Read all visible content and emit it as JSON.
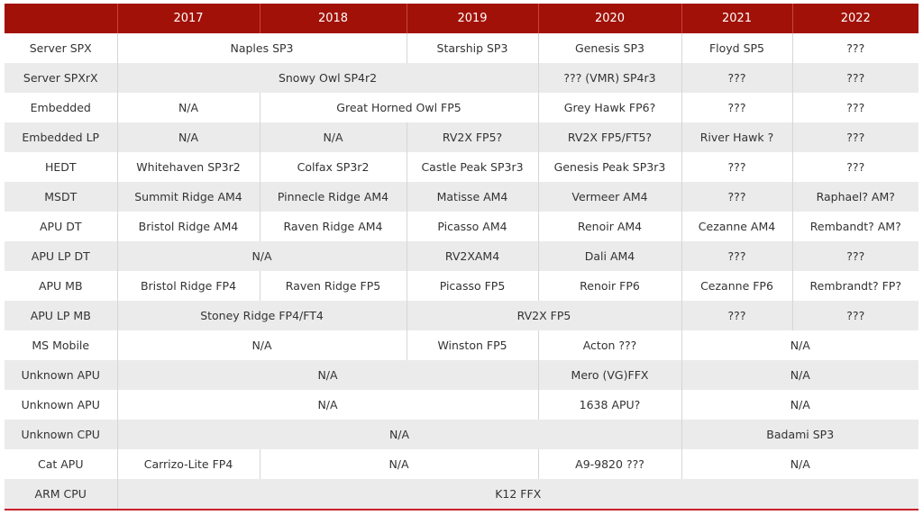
{
  "table": {
    "header": {
      "corner": "",
      "years": [
        "2017",
        "2018",
        "2019",
        "2020",
        "2021",
        "2022"
      ]
    },
    "accent_color": "#a11107",
    "rows": [
      {
        "label": "Server SPX",
        "cells": [
          {
            "text": "Naples SP3",
            "span": 2
          },
          {
            "text": "Starship SP3",
            "span": 1
          },
          {
            "text": "Genesis SP3",
            "span": 1
          },
          {
            "text": "Floyd SP5",
            "span": 1
          },
          {
            "text": "???",
            "span": 1
          }
        ]
      },
      {
        "label": "Server SPXrX",
        "cells": [
          {
            "text": "Snowy Owl SP4r2",
            "span": 3
          },
          {
            "text": "??? (VMR) SP4r3",
            "span": 1
          },
          {
            "text": "???",
            "span": 1
          },
          {
            "text": "???",
            "span": 1
          }
        ]
      },
      {
        "label": "Embedded",
        "cells": [
          {
            "text": "N/A",
            "span": 1
          },
          {
            "text": "Great Horned Owl FP5",
            "span": 2
          },
          {
            "text": "Grey Hawk FP6?",
            "span": 1
          },
          {
            "text": "???",
            "span": 1
          },
          {
            "text": "???",
            "span": 1
          }
        ]
      },
      {
        "label": "Embedded LP",
        "cells": [
          {
            "text": "N/A",
            "span": 1
          },
          {
            "text": "N/A",
            "span": 1
          },
          {
            "text": "RV2X FP5?",
            "span": 1
          },
          {
            "text": "RV2X FP5/FT5?",
            "span": 1
          },
          {
            "text": "River Hawk ?",
            "span": 1
          },
          {
            "text": "???",
            "span": 1
          }
        ]
      },
      {
        "label": "HEDT",
        "cells": [
          {
            "text": "Whitehaven SP3r2",
            "span": 1
          },
          {
            "text": "Colfax SP3r2",
            "span": 1
          },
          {
            "text": "Castle Peak SP3r3",
            "span": 1
          },
          {
            "text": "Genesis Peak SP3r3",
            "span": 1
          },
          {
            "text": "???",
            "span": 1
          },
          {
            "text": "???",
            "span": 1
          }
        ]
      },
      {
        "label": "MSDT",
        "cells": [
          {
            "text": "Summit Ridge AM4",
            "span": 1
          },
          {
            "text": "Pinnecle Ridge AM4",
            "span": 1
          },
          {
            "text": "Matisse AM4",
            "span": 1
          },
          {
            "text": "Vermeer AM4",
            "span": 1
          },
          {
            "text": "???",
            "span": 1
          },
          {
            "text": "Raphael? AM?",
            "span": 1
          }
        ]
      },
      {
        "label": "APU DT",
        "cells": [
          {
            "text": "Bristol Ridge AM4",
            "span": 1
          },
          {
            "text": "Raven Ridge AM4",
            "span": 1
          },
          {
            "text": "Picasso AM4",
            "span": 1
          },
          {
            "text": "Renoir AM4",
            "span": 1
          },
          {
            "text": "Cezanne AM4",
            "span": 1
          },
          {
            "text": "Rembandt? AM?",
            "span": 1
          }
        ]
      },
      {
        "label": "APU LP DT",
        "cells": [
          {
            "text": "N/A",
            "span": 2
          },
          {
            "text": "RV2XAM4",
            "span": 1
          },
          {
            "text": "Dali AM4",
            "span": 1
          },
          {
            "text": "???",
            "span": 1
          },
          {
            "text": "???",
            "span": 1
          }
        ]
      },
      {
        "label": "APU MB",
        "cells": [
          {
            "text": "Bristol Ridge FP4",
            "span": 1
          },
          {
            "text": "Raven Ridge FP5",
            "span": 1
          },
          {
            "text": "Picasso FP5",
            "span": 1
          },
          {
            "text": "Renoir FP6",
            "span": 1
          },
          {
            "text": "Cezanne FP6",
            "span": 1
          },
          {
            "text": "Rembrandt? FP?",
            "span": 1
          }
        ]
      },
      {
        "label": "APU LP MB",
        "cells": [
          {
            "text": "Stoney Ridge FP4/FT4",
            "span": 2
          },
          {
            "text": "RV2X FP5",
            "span": 2
          },
          {
            "text": "???",
            "span": 1
          },
          {
            "text": "???",
            "span": 1
          }
        ]
      },
      {
        "label": "MS Mobile",
        "cells": [
          {
            "text": "N/A",
            "span": 2
          },
          {
            "text": "Winston FP5",
            "span": 1
          },
          {
            "text": "Acton ???",
            "span": 1
          },
          {
            "text": "N/A",
            "span": 2
          }
        ]
      },
      {
        "label": "Unknown APU",
        "cells": [
          {
            "text": "N/A",
            "span": 3
          },
          {
            "text": "Mero (VG)FFX",
            "span": 1
          },
          {
            "text": "N/A",
            "span": 2
          }
        ]
      },
      {
        "label": "Unknown APU",
        "cells": [
          {
            "text": "N/A",
            "span": 3
          },
          {
            "text": "1638 APU?",
            "span": 1
          },
          {
            "text": "N/A",
            "span": 2
          }
        ]
      },
      {
        "label": "Unknown CPU",
        "cells": [
          {
            "text": "N/A",
            "span": 4
          },
          {
            "text": "Badami SP3",
            "span": 2
          }
        ]
      },
      {
        "label": "Cat APU",
        "cells": [
          {
            "text": "Carrizo-Lite FP4",
            "span": 1
          },
          {
            "text": "N/A",
            "span": 2
          },
          {
            "text": "A9-9820 ???",
            "span": 1
          },
          {
            "text": "N/A",
            "span": 2
          }
        ]
      },
      {
        "label": "ARM CPU",
        "cells": [
          {
            "text": "K12 FFX",
            "span": 6
          }
        ]
      }
    ]
  }
}
